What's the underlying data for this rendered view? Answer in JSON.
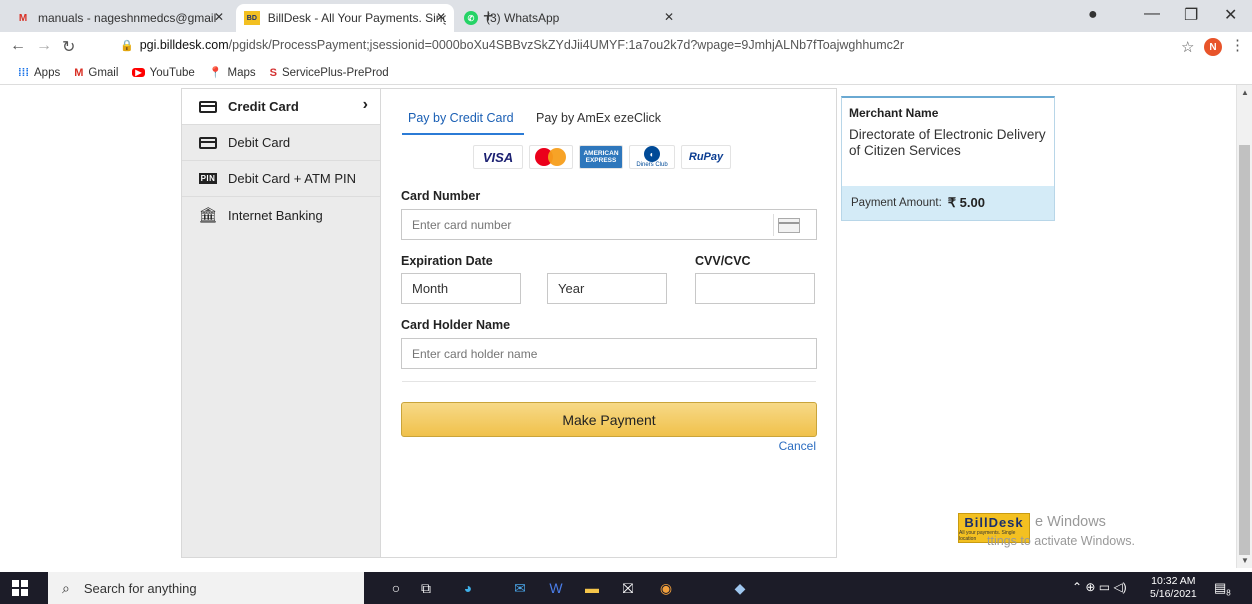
{
  "browser": {
    "tabs": [
      {
        "title": "manuals - nageshnmedcs@gmail",
        "favicon": "gmail-icon"
      },
      {
        "title": "BillDesk - All Your Payments. Sing",
        "favicon": "billdesk-icon"
      },
      {
        "title": "(3) WhatsApp",
        "favicon": "whatsapp-icon"
      }
    ],
    "new_tab": "+",
    "url_domain": "pgi.billdesk.com",
    "url_path": "/pgidsk/ProcessPayment;jsessionid=0000boXu4SBBvzSkZYdJii4UMYF:1a7ou2k7d?wpage=9JmhjALNb7fToajwghhumc2r",
    "profile_initial": "N",
    "bookmarks": [
      "Apps",
      "Gmail",
      "YouTube",
      "Maps",
      "ServicePlus-PreProd"
    ]
  },
  "payment_methods": [
    {
      "label": "Credit Card",
      "icon": "credit-card-icon"
    },
    {
      "label": "Debit Card",
      "icon": "debit-card-icon"
    },
    {
      "label": "Debit Card + ATM PIN",
      "icon": "pin-icon",
      "badge": "PIN"
    },
    {
      "label": "Internet Banking",
      "icon": "bank-icon"
    }
  ],
  "form": {
    "tabs": [
      "Pay by Credit Card",
      "Pay by AmEx ezeClick"
    ],
    "card_logos": [
      "VISA",
      "AMERICAN EXPRESS",
      "Diners Club",
      "RuPay"
    ],
    "card_number_label": "Card Number",
    "card_number_placeholder": "Enter card number",
    "expiration_label": "Expiration Date",
    "month_value": "Month",
    "year_value": "Year",
    "cvv_label": "CVV/CVC",
    "holder_label": "Card Holder Name",
    "holder_placeholder": "Enter card holder name",
    "submit_label": "Make Payment",
    "cancel_label": "Cancel"
  },
  "merchant": {
    "label": "Merchant Name",
    "name": "Directorate of Electronic Delivery of Citizen Services",
    "amount_label": "Payment Amount:",
    "amount_value": "₹ 5.00"
  },
  "branding": {
    "logo_text": "BillDesk",
    "logo_tagline": "All your payments. Single location",
    "watermark_line1": "e Windows",
    "watermark_line2": "ttings to activate Windows."
  },
  "taskbar": {
    "search_placeholder": "Search for anything",
    "time": "10:32 AM",
    "date": "5/16/2021",
    "notification_count": "8"
  },
  "colors": {
    "accent_blue": "#2b7bd6",
    "button_yellow": "#f0c14b",
    "merchant_amount_bg": "#d4ebf7"
  }
}
